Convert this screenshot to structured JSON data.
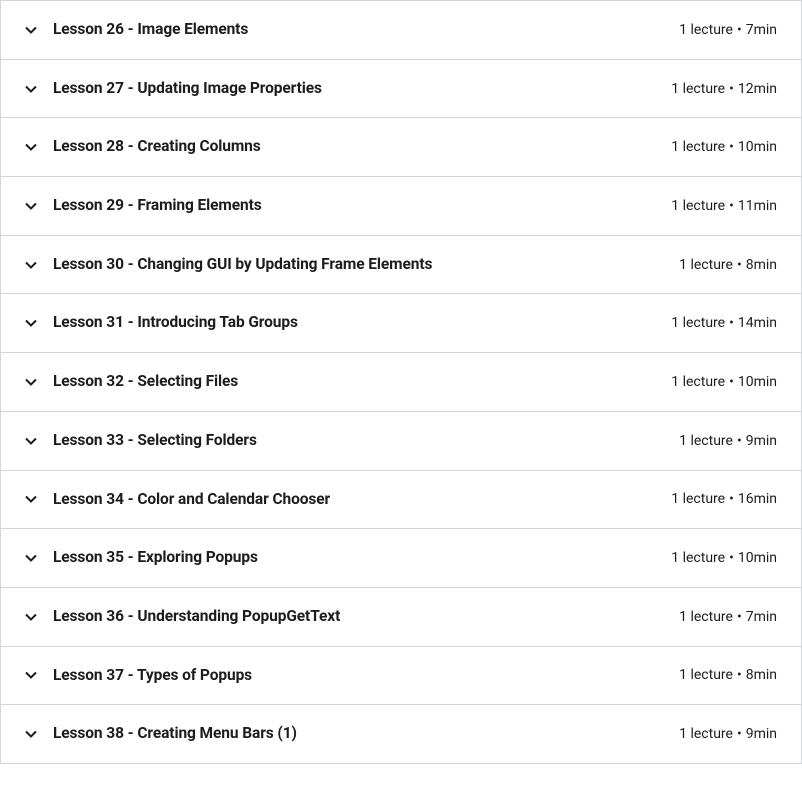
{
  "lessons": [
    {
      "title": "Lesson 26 - Image Elements",
      "lectures": "1 lecture",
      "duration": "7min"
    },
    {
      "title": "Lesson 27 - Updating Image Properties",
      "lectures": "1 lecture",
      "duration": "12min"
    },
    {
      "title": "Lesson 28 - Creating Columns",
      "lectures": "1 lecture",
      "duration": "10min"
    },
    {
      "title": "Lesson 29 - Framing Elements",
      "lectures": "1 lecture",
      "duration": "11min"
    },
    {
      "title": "Lesson 30 - Changing GUI by Updating Frame Elements",
      "lectures": "1 lecture",
      "duration": "8min"
    },
    {
      "title": "Lesson 31 - Introducing Tab Groups",
      "lectures": "1 lecture",
      "duration": "14min"
    },
    {
      "title": "Lesson 32 - Selecting Files",
      "lectures": "1 lecture",
      "duration": "10min"
    },
    {
      "title": "Lesson 33 - Selecting Folders",
      "lectures": "1 lecture",
      "duration": "9min"
    },
    {
      "title": "Lesson 34 - Color and Calendar Chooser",
      "lectures": "1 lecture",
      "duration": "16min"
    },
    {
      "title": "Lesson 35 - Exploring Popups",
      "lectures": "1 lecture",
      "duration": "10min"
    },
    {
      "title": "Lesson 36 - Understanding PopupGetText",
      "lectures": "1 lecture",
      "duration": "7min"
    },
    {
      "title": "Lesson 37 - Types of Popups",
      "lectures": "1 lecture",
      "duration": "8min"
    },
    {
      "title": "Lesson 38 - Creating Menu Bars (1)",
      "lectures": "1 lecture",
      "duration": "9min"
    }
  ],
  "separator": "•"
}
